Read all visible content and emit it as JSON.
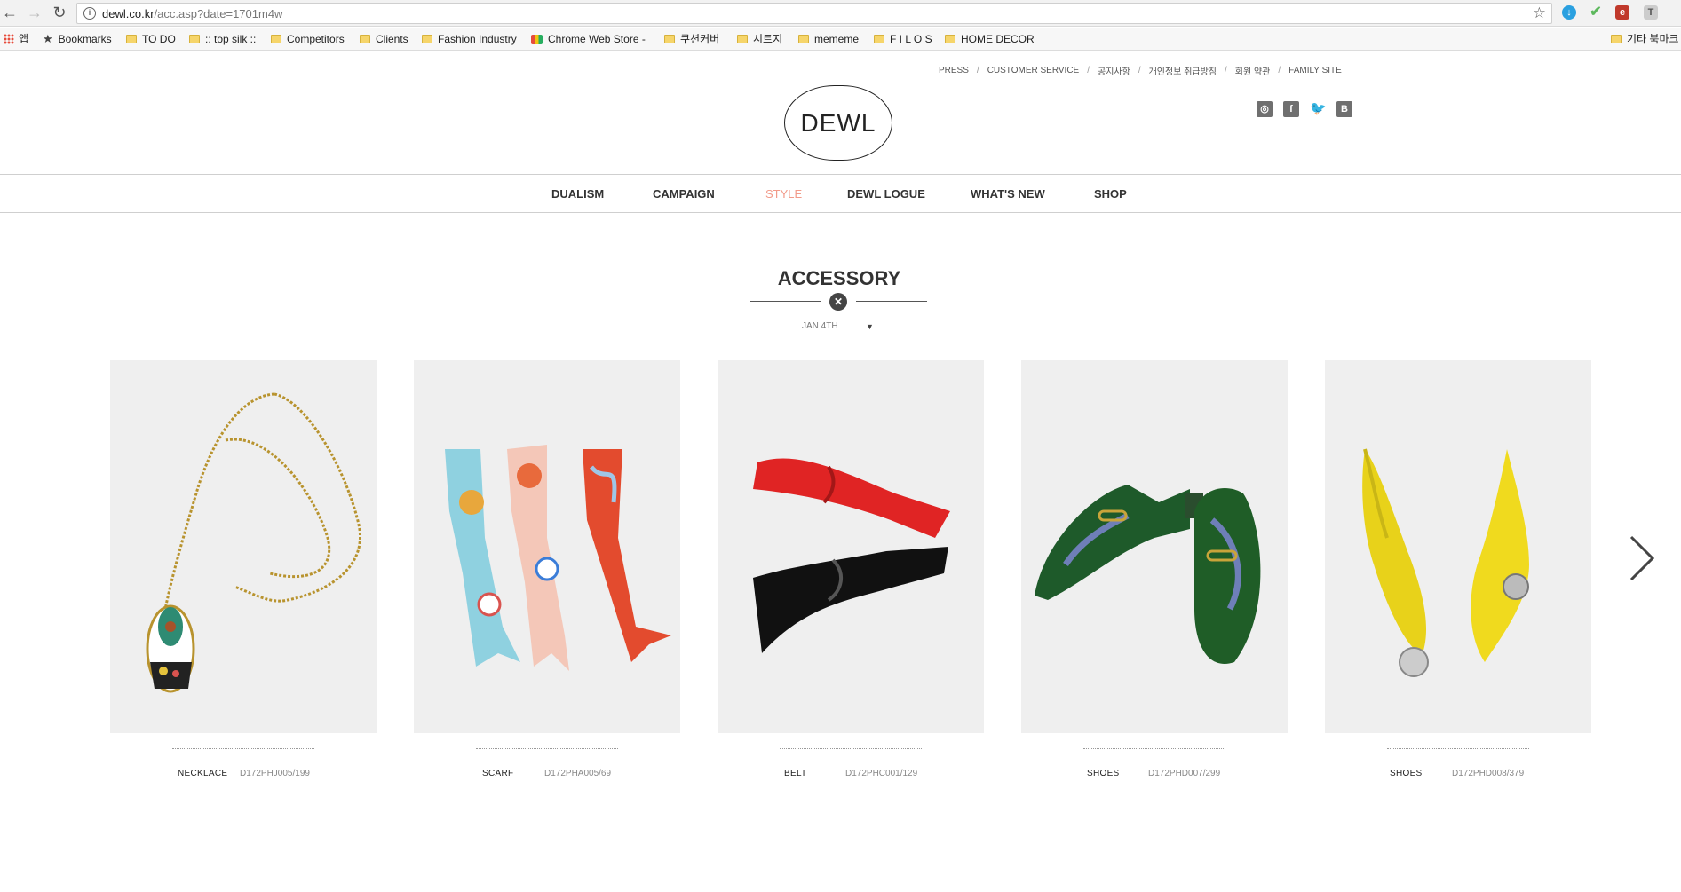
{
  "browser": {
    "url_host": "dewl.co.kr",
    "url_path": "/acc.asp?date=1701m4w",
    "bookmarks": [
      {
        "label": "앱",
        "icon": "apps-icon"
      },
      {
        "label": "Bookmarks",
        "icon": "star-icon"
      },
      {
        "label": "TO DO",
        "icon": "folder-icon"
      },
      {
        "label": ":: top silk ::",
        "icon": "folder-icon"
      },
      {
        "label": "Competitors",
        "icon": "folder-icon"
      },
      {
        "label": "Clients",
        "icon": "folder-icon"
      },
      {
        "label": "Fashion Industry",
        "icon": "folder-icon"
      },
      {
        "label": "Chrome Web Store -",
        "icon": "chrome-store-icon"
      },
      {
        "label": "쿠션커버",
        "icon": "folder-icon"
      },
      {
        "label": "시트지",
        "icon": "folder-icon"
      },
      {
        "label": "mememe",
        "icon": "folder-icon"
      },
      {
        "label": "F I L O S",
        "icon": "folder-icon"
      },
      {
        "label": "HOME DECOR",
        "icon": "folder-icon"
      },
      {
        "label": "기타 북마크",
        "icon": "folder-icon"
      }
    ]
  },
  "header": {
    "util_links": [
      "PRESS",
      "CUSTOMER SERVICE",
      "공지사항",
      "개인정보 취급방침",
      "회원 약관",
      "FAMILY SITE"
    ],
    "logo_text": "DEWL",
    "social": [
      "instagram-icon",
      "facebook-icon",
      "twitter-icon",
      "blog-icon"
    ]
  },
  "nav": {
    "items": [
      "DUALISM",
      "CAMPAIGN",
      "STYLE",
      "DEWL LOGUE",
      "WHAT'S NEW",
      "SHOP"
    ],
    "active": "STYLE",
    "active_color": "#f29b8a"
  },
  "section": {
    "title": "ACCESSORY",
    "date_selected": "JAN 4TH"
  },
  "products": [
    {
      "category": "NECKLACE",
      "code": "D172PHJ005/199"
    },
    {
      "category": "SCARF",
      "code": "D172PHA005/69"
    },
    {
      "category": "BELT",
      "code": "D172PHC001/129"
    },
    {
      "category": "SHOES",
      "code": "D172PHD007/299"
    },
    {
      "category": "SHOES",
      "code": "D172PHD008/379"
    }
  ]
}
